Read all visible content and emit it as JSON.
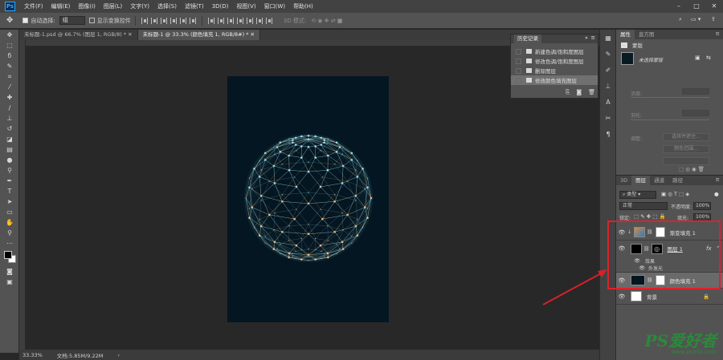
{
  "app": {
    "logo": "Ps"
  },
  "menu": [
    "文件(F)",
    "编辑(E)",
    "图像(I)",
    "图层(L)",
    "文字(Y)",
    "选择(S)",
    "滤镜(T)",
    "3D(D)",
    "视图(V)",
    "窗口(W)",
    "帮助(H)"
  ],
  "window_controls": [
    "–",
    "□",
    "✕"
  ],
  "options": {
    "auto_select_label": "自动选择:",
    "auto_select_value": "组",
    "transform_label": "显示变换控件",
    "mode_3d": "3D 模式:"
  },
  "tabs": [
    "未标题-1.psd @ 66.7% (图层 1, RGB/8) *",
    "未标题-1 @ 33.3% (颜色填充 1, RGB/8#) *"
  ],
  "status": {
    "zoom": "33.33%",
    "doc": "文档:5.85M/9.22M"
  },
  "history": {
    "title": "历史记录",
    "items": [
      "新建色调/饱和度图层",
      "修改色调/饱和度图层",
      "删除图层",
      "修改颜色填充图层"
    ]
  },
  "properties": {
    "tabs": [
      "属性",
      "直方图"
    ],
    "section": "蒙版",
    "mask_label": "未选择蒙版",
    "density": "浓度:",
    "feather": "羽化:",
    "adjust": "调整:",
    "select_btn": "选择并遮住...",
    "color_range_btn": "颜色范围..."
  },
  "layers": {
    "tabs": [
      "3D",
      "图层",
      "通道",
      "路径"
    ],
    "kind": "类型",
    "blend": "正常",
    "opacity_label": "不透明度:",
    "opacity": "100%",
    "lock_label": "锁定:",
    "fill_label": "填充:",
    "fill": "100%",
    "items": [
      {
        "name": "渐变填充 1"
      },
      {
        "name": "图层 1"
      },
      {
        "name": "效果"
      },
      {
        "name": "外发光"
      },
      {
        "name": "颜色填充 1"
      },
      {
        "name": "背景"
      }
    ]
  },
  "watermark": {
    "big": "PS爱好者",
    "small": "www.psahz.com"
  },
  "colors": {
    "accent": "#31a8ff",
    "highlight": "#e0202a",
    "arrow": "#d8202a"
  }
}
